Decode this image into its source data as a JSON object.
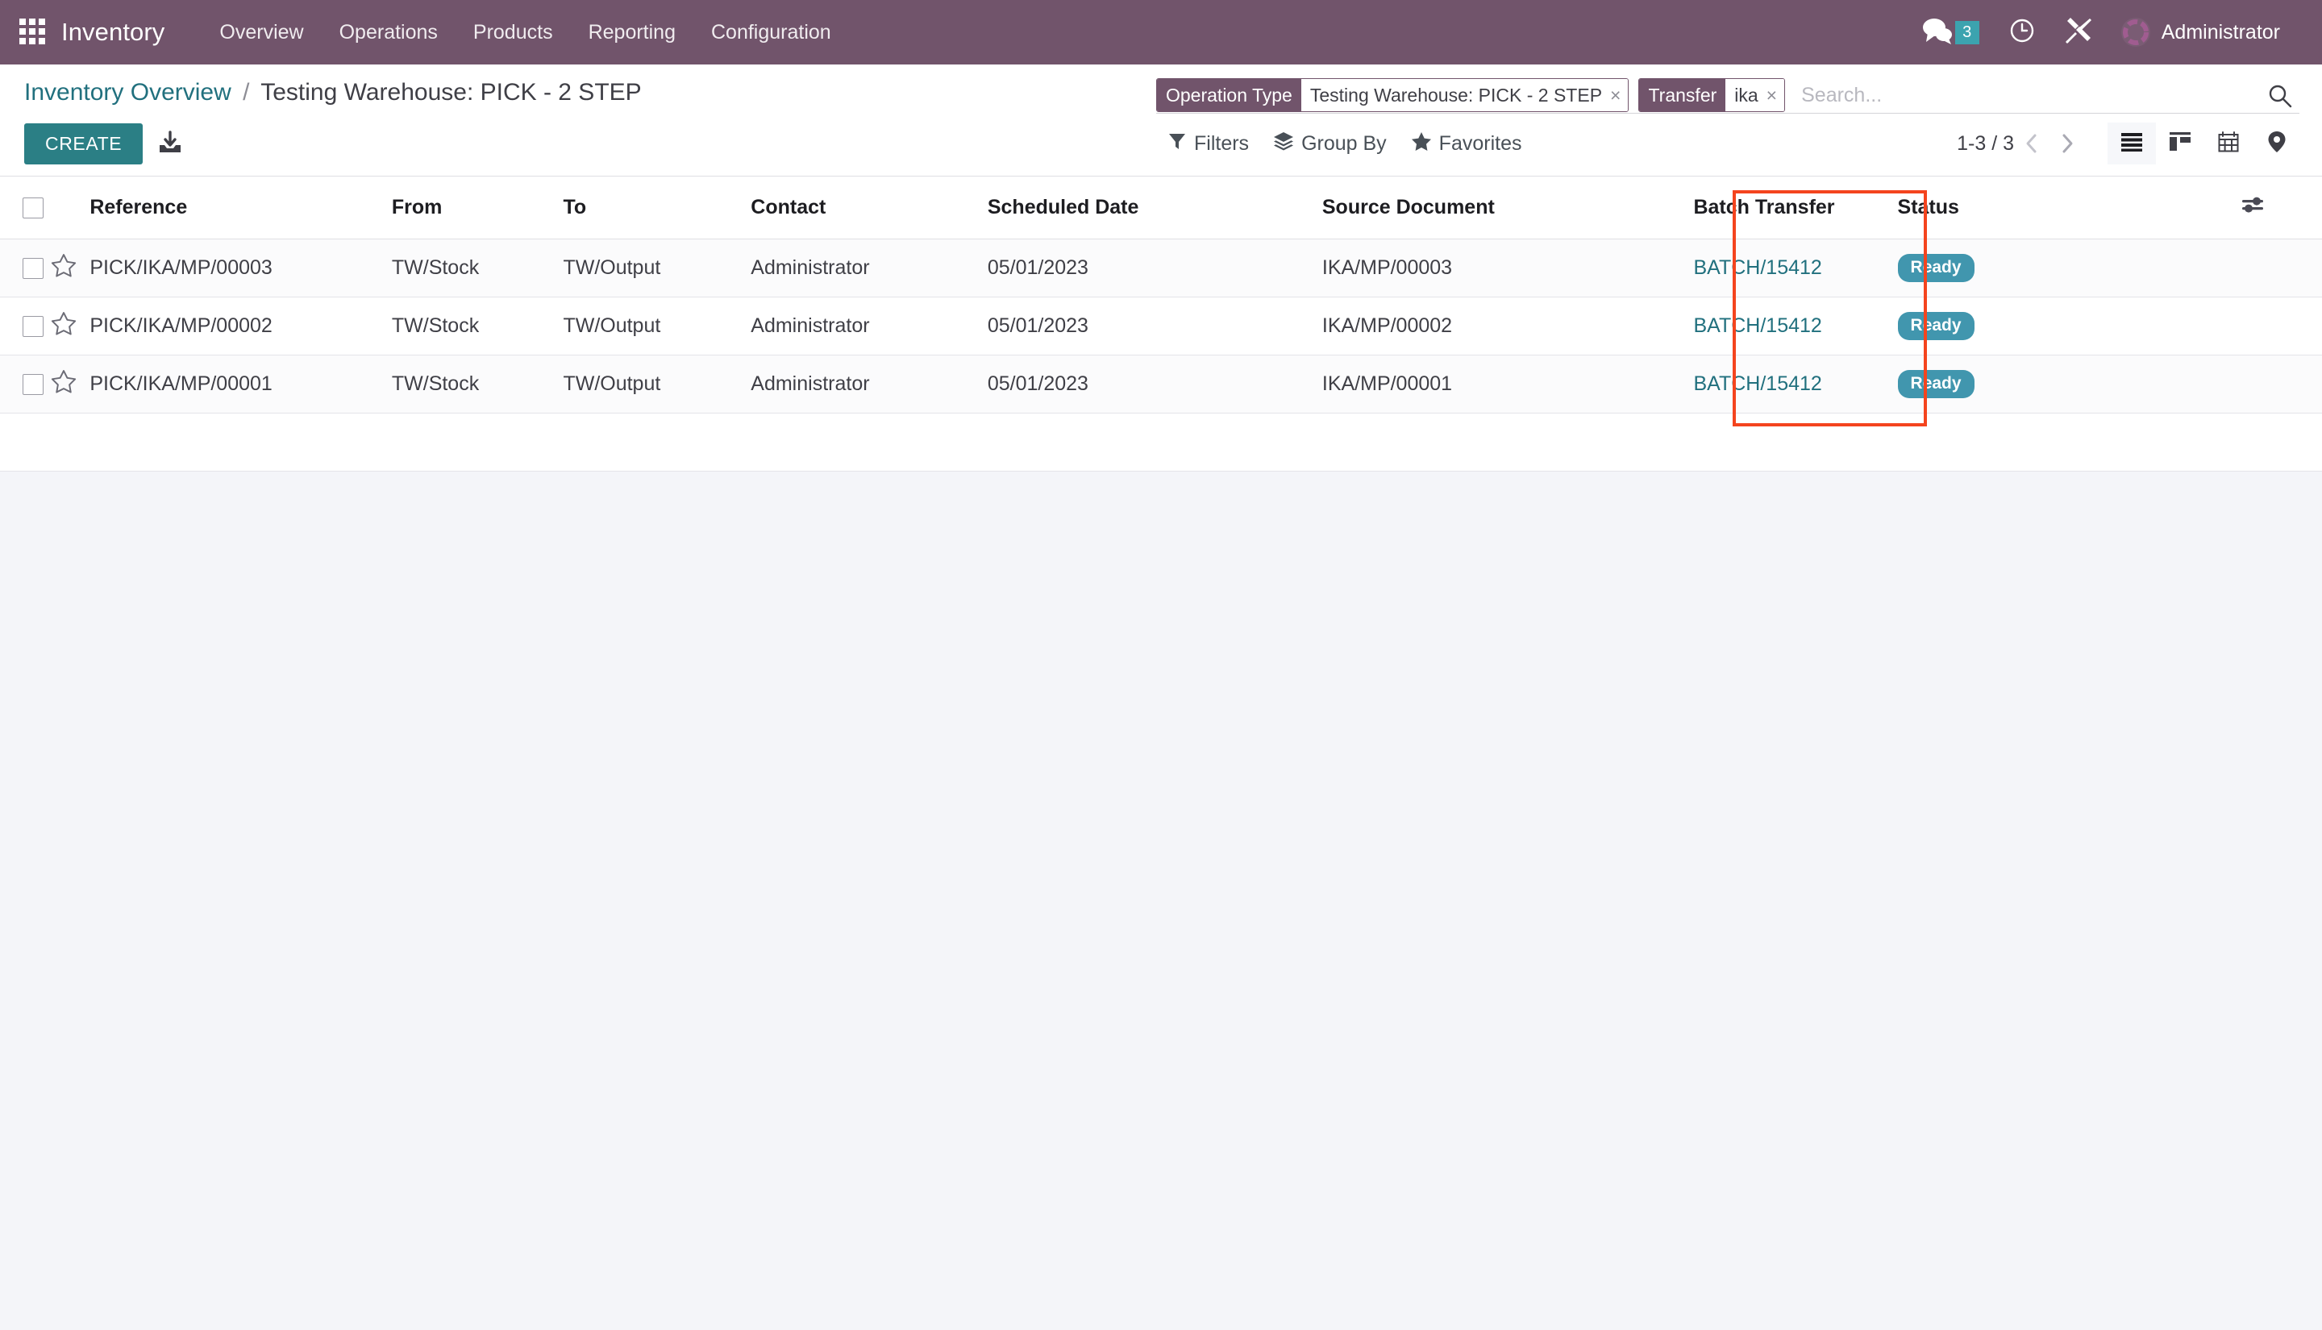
{
  "navbar": {
    "apps_icon": "apps-grid-icon",
    "brand": "Inventory",
    "menu": [
      {
        "label": "Overview",
        "name": "menu-overview"
      },
      {
        "label": "Operations",
        "name": "menu-operations"
      },
      {
        "label": "Products",
        "name": "menu-products"
      },
      {
        "label": "Reporting",
        "name": "menu-reporting"
      },
      {
        "label": "Configuration",
        "name": "menu-configuration"
      }
    ],
    "messages_icon": "messages-icon",
    "messages_count": "3",
    "activities_icon": "clock-icon",
    "debug_icon": "tools-icon",
    "avatar_icon": "avatar",
    "user_name": "Administrator",
    "bg_color": "#71546b",
    "badge_color": "#3ca3af"
  },
  "breadcrumb": {
    "root": "Inventory Overview",
    "separator": "/",
    "current": "Testing Warehouse: PICK - 2 STEP",
    "link_color": "#21707e"
  },
  "search": {
    "placeholder": "Search...",
    "value": "",
    "magnifier_icon": "search-icon",
    "facets": [
      {
        "label": "Operation Type",
        "value": "Testing Warehouse: PICK - 2 STEP",
        "remove": "×"
      },
      {
        "label": "Transfer",
        "value": "ika",
        "remove": "×"
      }
    ]
  },
  "toolbar": {
    "create_label": "CREATE",
    "create_color": "#2b7f85",
    "import_icon": "import-download-icon",
    "filters_label": "Filters",
    "filters_icon": "funnel-icon",
    "groupby_label": "Group By",
    "groupby_icon": "layers-icon",
    "favorites_label": "Favorites",
    "favorites_icon": "star-icon",
    "pager_text": "1-3 / 3",
    "pager_prev_icon": "chevron-left-icon",
    "pager_next_icon": "chevron-right-icon",
    "views": [
      {
        "name": "view-list",
        "icon": "list-icon",
        "active": true
      },
      {
        "name": "view-kanban",
        "icon": "kanban-icon",
        "active": false
      },
      {
        "name": "view-calendar",
        "icon": "calendar-icon",
        "active": false
      },
      {
        "name": "view-map",
        "icon": "map-pin-icon",
        "active": false
      }
    ]
  },
  "table": {
    "headers": {
      "reference": "Reference",
      "from": "From",
      "to": "To",
      "contact": "Contact",
      "scheduled_date": "Scheduled Date",
      "source_document": "Source Document",
      "batch_transfer": "Batch Transfer",
      "status": "Status",
      "options_icon": "sliders-icon"
    },
    "rows": [
      {
        "star_icon": "star-outline-icon",
        "reference": "PICK/IKA/MP/00003",
        "from": "TW/Stock",
        "to": "TW/Output",
        "contact": "Administrator",
        "scheduled_date": "05/01/2023",
        "source_document": "IKA/MP/00003",
        "batch_transfer": "BATCH/15412",
        "status": "Ready"
      },
      {
        "star_icon": "star-outline-icon",
        "reference": "PICK/IKA/MP/00002",
        "from": "TW/Stock",
        "to": "TW/Output",
        "contact": "Administrator",
        "scheduled_date": "05/01/2023",
        "source_document": "IKA/MP/00002",
        "batch_transfer": "BATCH/15412",
        "status": "Ready"
      },
      {
        "star_icon": "star-outline-icon",
        "reference": "PICK/IKA/MP/00001",
        "from": "TW/Stock",
        "to": "TW/Output",
        "contact": "Administrator",
        "scheduled_date": "05/01/2023",
        "source_document": "IKA/MP/00001",
        "batch_transfer": "BATCH/15412",
        "status": "Ready"
      }
    ],
    "date_color": "#c0392b",
    "link_color": "#21707e",
    "status_badge_color": "#4196ae"
  },
  "annotation": {
    "name": "batch-transfer-column-highlight",
    "color": "#f4441e"
  }
}
